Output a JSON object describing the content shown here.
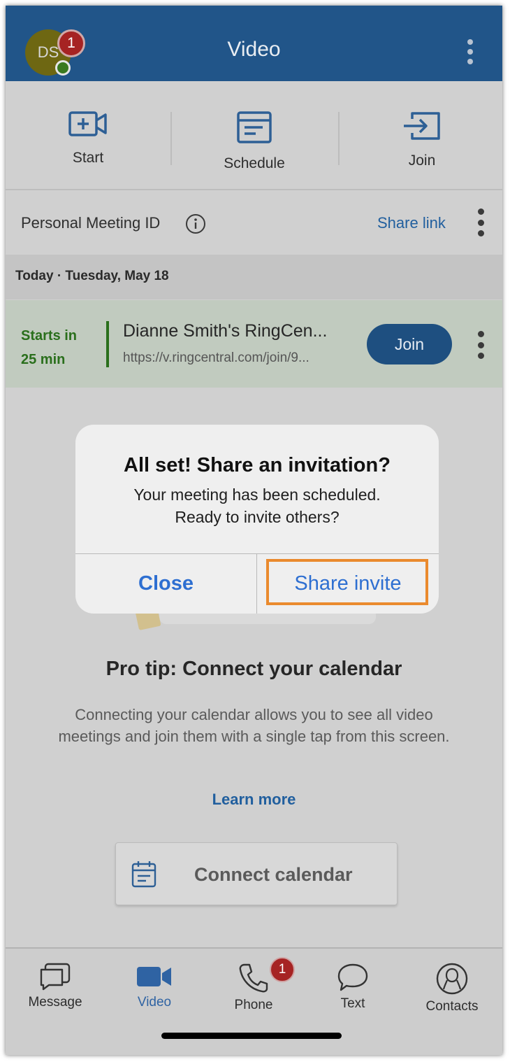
{
  "header": {
    "title": "Video",
    "avatar_initials": "DS",
    "avatar_badge": "1"
  },
  "actions": [
    {
      "label": "Start",
      "icon": "video-plus-icon"
    },
    {
      "label": "Schedule",
      "icon": "calendar-list-icon"
    },
    {
      "label": "Join",
      "icon": "enter-icon"
    }
  ],
  "pmi": {
    "label": "Personal Meeting ID",
    "share_link": "Share link"
  },
  "date_label": "Today · Tuesday, May 18",
  "meeting": {
    "starts_line1": "Starts in",
    "starts_line2": "25 min",
    "title": "Dianne Smith's RingCen...",
    "url": "https://v.ringcentral.com/join/9...",
    "join_label": "Join"
  },
  "dialog": {
    "title": "All set! Share an invitation?",
    "message_line1": "Your meeting has been scheduled.",
    "message_line2": "Ready to invite others?",
    "close_label": "Close",
    "share_label": "Share invite"
  },
  "pro_tip": {
    "title": "Pro tip: Connect your calendar",
    "body": "Connecting your calendar allows you to see all video meetings and join them with a single tap from this screen.",
    "learn_more": "Learn more",
    "connect_label": "Connect calendar"
  },
  "tabs": [
    {
      "label": "Message",
      "icon": "message-icon"
    },
    {
      "label": "Video",
      "icon": "video-icon",
      "active": true
    },
    {
      "label": "Phone",
      "icon": "phone-icon",
      "badge": "1"
    },
    {
      "label": "Text",
      "icon": "text-bubble-icon"
    },
    {
      "label": "Contacts",
      "icon": "contacts-icon"
    }
  ],
  "colors": {
    "header_bg": "#215589",
    "accent_blue": "#215f9e",
    "green": "#2a6f1c",
    "highlight_orange": "#ea8a2e",
    "badge_red": "#a62323"
  }
}
